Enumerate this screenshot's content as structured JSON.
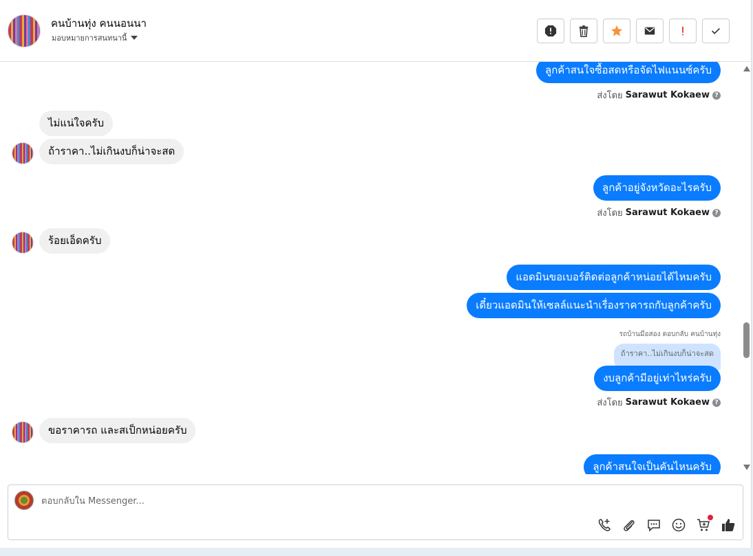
{
  "header": {
    "name": "คนบ้านทุ่ง คนนอนนา",
    "assignment": "มอบหมายการสนทนานี้",
    "action_icons": [
      "report-icon",
      "trash-icon",
      "star-icon",
      "mail-icon",
      "exclamation-icon",
      "check-icon"
    ],
    "star_color": "#f7923a"
  },
  "messages": {
    "m1": "ลูกค้าสนใจซื้อสดหรือจัดไฟแนนซ์ครับ",
    "m1_sent_prefix": "ส่งโดย",
    "m1_sent_by": "Sarawut Kokaew",
    "m2": "ไม่แน่ใจครับ",
    "m3": "ถ้าราคา..ไม่เกินงบก็น่าจะสด",
    "m4": "ลูกค้าอยู่จังหวัดอะไรครับ",
    "m4_sent_prefix": "ส่งโดย",
    "m4_sent_by": "Sarawut Kokaew",
    "m5": "ร้อยเอ็ดครับ",
    "m6": "แอดมินขอเบอร์ติดต่อลูกค้าหน่อยได้ไหมครับ",
    "m7": "เดี๋ยวแอดมินให้เซลล์แนะนำเรื่องราคารถกับลูกค้าครับ",
    "m8_reply_label": "รถบ้านมือสอง ตอบกลับ คนบ้านทุ่ง",
    "m8_quote": "ถ้าราคา..ไม่เกินงบก็น่าจะสด",
    "m8": "งบลูกค้ามีอยู่เท่าไหร่ครับ",
    "m8_sent_prefix": "ส่งโดย",
    "m8_sent_by": "Sarawut Kokaew",
    "m9": "ขอราคารถ และสเป็กหน่อยครับ",
    "m10": "ลูกค้าสนใจเป็นคันไหนครับ",
    "outgoing_color": "#0a7cff",
    "incoming_color": "#f0f0f0"
  },
  "composer": {
    "placeholder": "ตอบกลับใน Messenger...",
    "tools": [
      "add-call-icon",
      "attachment-icon",
      "saved-reply-icon",
      "emoji-icon",
      "cart-icon",
      "like-icon"
    ]
  }
}
